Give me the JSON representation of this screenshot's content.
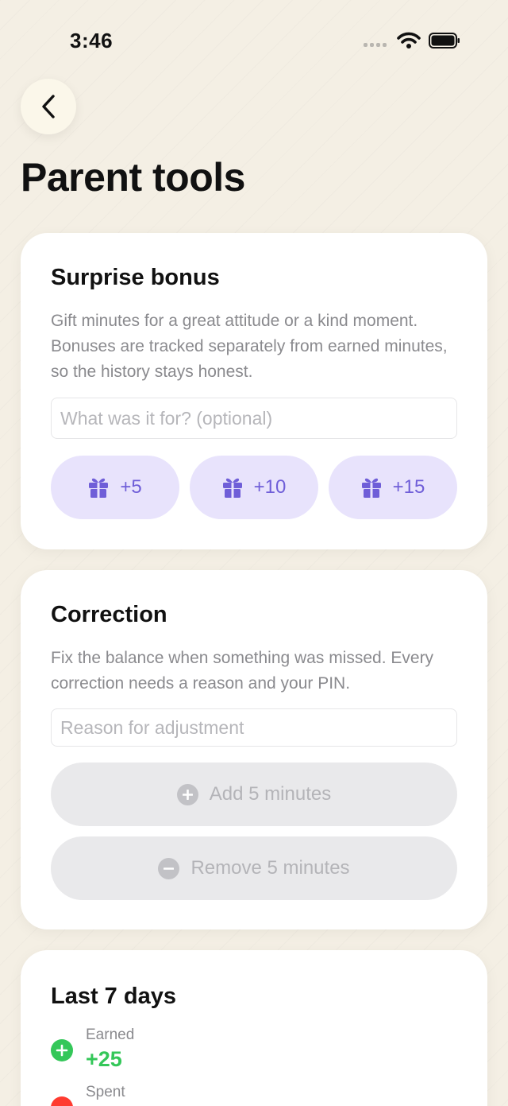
{
  "status_bar": {
    "time": "3:46"
  },
  "header": {
    "title": "Parent tools"
  },
  "surprise_bonus": {
    "title": "Surprise bonus",
    "description": "Gift minutes for a great attitude or a kind moment. Bonuses are tracked separately from earned minutes, so the history stays honest.",
    "input_placeholder": "What was it for? (optional)",
    "buttons": [
      "+5",
      "+10",
      "+15"
    ],
    "accent_color": "#6f5ed8"
  },
  "correction": {
    "title": "Correction",
    "description": "Fix the balance when something was missed. Every correction needs a reason and your PIN.",
    "input_placeholder": "Reason for adjustment",
    "add_label": "Add 5 minutes",
    "remove_label": "Remove 5 minutes"
  },
  "last_7_days": {
    "title": "Last 7 days",
    "earned_label": "Earned",
    "earned_value": "+25",
    "earned_color": "#34c759",
    "spent_label": "Spent",
    "spent_color": "#ff3b30"
  }
}
